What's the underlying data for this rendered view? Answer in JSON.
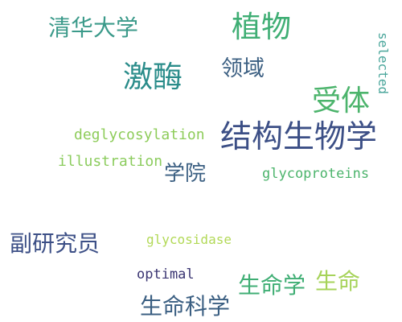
{
  "words": [
    {
      "id": "qinghua",
      "text": "清华大学",
      "color": "#3b9a8a"
    },
    {
      "id": "zhiwu",
      "text": "植物",
      "color": "#3fae74"
    },
    {
      "id": "jiaomei",
      "text": "激酶",
      "color": "#2a8c8a"
    },
    {
      "id": "lingyu",
      "text": "领域",
      "color": "#3b5f82"
    },
    {
      "id": "shouti",
      "text": "受体",
      "color": "#4cb46c"
    },
    {
      "id": "selected",
      "text": "selected",
      "color": "#4aa69b"
    },
    {
      "id": "jiegou",
      "text": "结构生物学",
      "color": "#3c4f86"
    },
    {
      "id": "deglycosylation",
      "text": "deglycosylation",
      "color": "#8ecc5a"
    },
    {
      "id": "illustration",
      "text": "illustration",
      "color": "#8ccc5e"
    },
    {
      "id": "xueyuan",
      "text": "学院",
      "color": "#3b5f82"
    },
    {
      "id": "glycoproteins",
      "text": "glycoproteins",
      "color": "#4cb46c"
    },
    {
      "id": "fuyanjiuyuan",
      "text": "副研究员",
      "color": "#3c4f86"
    },
    {
      "id": "glycosidase",
      "text": "glycosidase",
      "color": "#b2d957"
    },
    {
      "id": "optimal",
      "text": "optimal",
      "color": "#3a3572"
    },
    {
      "id": "shengmingxue",
      "text": "生命学",
      "color": "#3fae74"
    },
    {
      "id": "shengming",
      "text": "生命",
      "color": "#a6d35a"
    },
    {
      "id": "shengmingkexue",
      "text": "生命科学",
      "color": "#3b5f82"
    }
  ]
}
